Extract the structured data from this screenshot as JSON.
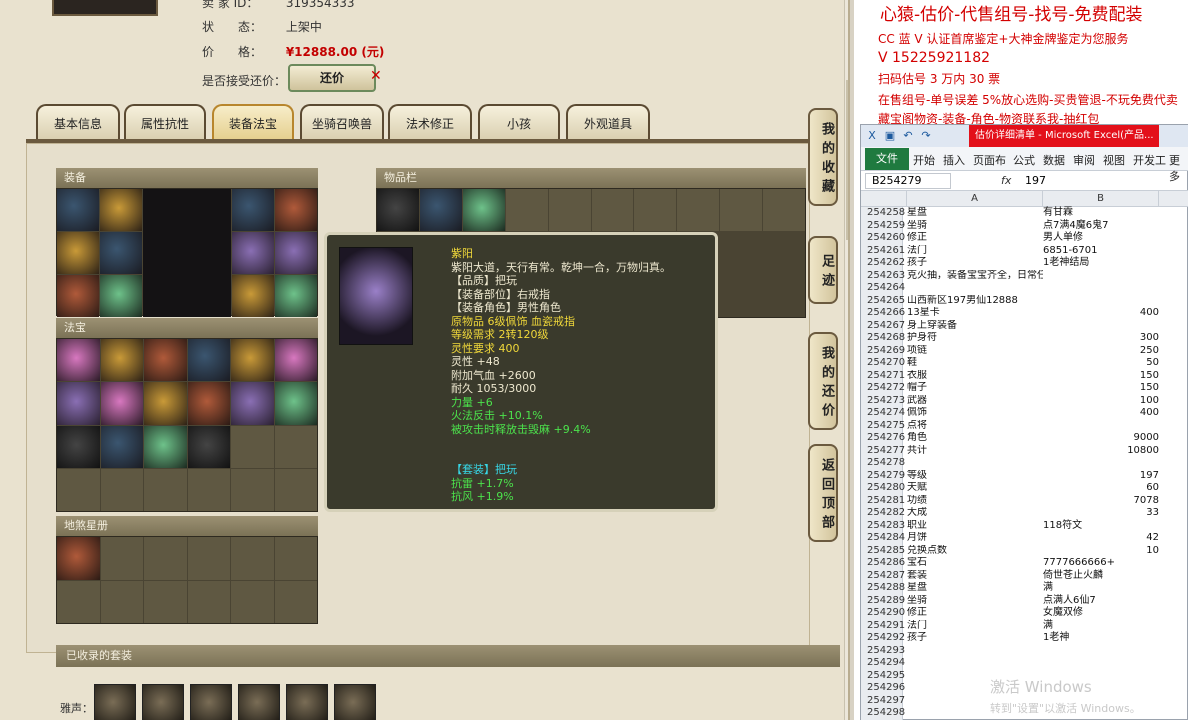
{
  "item_info": {
    "seller_label": "卖 家 ID：",
    "seller_value": "319354333",
    "status_label": "状　　态：",
    "status_value": "上架中",
    "price_label": "价　　格：",
    "price_value": "¥12888.00 (元)",
    "offer_label": "是否接受还价：",
    "offer_button": "还价"
  },
  "tabs": [
    "基本信息",
    "属性抗性",
    "装备法宝",
    "坐骑召唤兽",
    "法术修正",
    "小孩",
    "外观道具"
  ],
  "sections": {
    "equipment": "装备",
    "inventory": "物品栏",
    "fabao": "法宝",
    "fushi": "地煞星册",
    "collected_sets": "已收录的套装",
    "sets_row_label": "雅声："
  },
  "side_buttons": [
    "我的收藏",
    "足迹",
    "我的还价",
    "返回顶部"
  ],
  "tooltip": {
    "name": "紫阳",
    "lines": [
      {
        "text": "紫阳大道，天行有常。乾坤一合，万物归真。",
        "color": "white"
      },
      {
        "text": "【品质】把玩",
        "color": "white"
      },
      {
        "text": "【装备部位】右戒指",
        "color": "white"
      },
      {
        "text": "【装备角色】男性角色",
        "color": "white"
      },
      {
        "text": "原物品 6级佩饰 血瓷戒指",
        "color": "gold"
      },
      {
        "text": "等级需求 2转120级",
        "color": "gold"
      },
      {
        "text": "灵性要求 400",
        "color": "gold"
      },
      {
        "text": "灵性 +48",
        "color": "white"
      },
      {
        "text": "附加气血 +2600",
        "color": "white"
      },
      {
        "text": "耐久 1053/3000",
        "color": "white"
      },
      {
        "text": "力量 +6",
        "color": "green"
      },
      {
        "text": "火法反击 +10.1%",
        "color": "green"
      },
      {
        "text": "被攻击时释放击毁麻 +9.4%",
        "color": "green"
      },
      {
        "text": "",
        "color": "white"
      },
      {
        "text": "",
        "color": "white"
      },
      {
        "text": "【套装】把玩",
        "color": "cyan"
      },
      {
        "text": "抗雷 +1.7%",
        "color": "green"
      },
      {
        "text": "抗风 +1.9%",
        "color": "green"
      }
    ]
  },
  "ad": {
    "title": "心猿-估价-代售组号-找号-免费配装",
    "line1": "CC 蓝 V 认证首席鉴定+大神金牌鉴定为您服务",
    "line2": "V 15225921182",
    "line3": "扫码估号 3 万内 30 票",
    "line4": "在售组号-单号误差 5%放心选购-买贵管退-不玩免费代卖",
    "line5": "藏宝阁物资-装备-角色-物资联系我-抽红包"
  },
  "excel": {
    "title": "估价详细清单 - Microsoft Excel(产品...",
    "file_tab": "文件",
    "ribbon_tabs": [
      "开始",
      "插入",
      "页面布",
      "公式",
      "数据",
      "审阅",
      "视图",
      "开发工",
      "更多"
    ],
    "name_box": "B254279",
    "fx": "fx",
    "formula_value": "197",
    "col_a": "A",
    "col_b": "B",
    "rows": [
      {
        "n": "254258",
        "a": "星盘",
        "b": "有甘霖",
        "num": false
      },
      {
        "n": "254259",
        "a": "坐骑",
        "b": "点7满4魔6鬼7",
        "num": false
      },
      {
        "n": "254260",
        "a": "修正",
        "b": "男人单修",
        "num": false
      },
      {
        "n": "254261",
        "a": "法门",
        "b": "6851-6701",
        "num": false
      },
      {
        "n": "254262",
        "a": "孩子",
        "b": "1老神结局",
        "num": false
      },
      {
        "n": "254263",
        "a": "克火抽，装备宝宝齐全，日常任务副本满抽",
        "b": "",
        "num": false
      },
      {
        "n": "254264",
        "a": "",
        "b": "",
        "num": false
      },
      {
        "n": "254265",
        "a": "山西新区197男仙12888",
        "b": "",
        "num": false
      },
      {
        "n": "254266",
        "a": "13星卡",
        "b": "400",
        "num": true
      },
      {
        "n": "254267",
        "a": "身上穿装备",
        "b": "",
        "num": false
      },
      {
        "n": "254268",
        "a": "护身符",
        "b": "300",
        "num": true
      },
      {
        "n": "254269",
        "a": "项链",
        "b": "250",
        "num": true
      },
      {
        "n": "254270",
        "a": "鞋",
        "b": "50",
        "num": true
      },
      {
        "n": "254271",
        "a": "衣服",
        "b": "150",
        "num": true
      },
      {
        "n": "254272",
        "a": "帽子",
        "b": "150",
        "num": true
      },
      {
        "n": "254273",
        "a": "武器",
        "b": "100",
        "num": true
      },
      {
        "n": "254274",
        "a": "佩饰",
        "b": "400",
        "num": true
      },
      {
        "n": "254275",
        "a": "点将",
        "b": "",
        "num": false
      },
      {
        "n": "254276",
        "a": "角色",
        "b": "9000",
        "num": true
      },
      {
        "n": "254277",
        "a": "共计",
        "b": "10800",
        "num": true
      },
      {
        "n": "254278",
        "a": "",
        "b": "",
        "num": false
      },
      {
        "n": "254279",
        "a": "等级",
        "b": "197",
        "num": true
      },
      {
        "n": "254280",
        "a": "天赋",
        "b": "60",
        "num": true
      },
      {
        "n": "254281",
        "a": "功绩",
        "b": "7078",
        "num": true
      },
      {
        "n": "254282",
        "a": "大成",
        "b": "33",
        "num": true
      },
      {
        "n": "254283",
        "a": "职业",
        "b": "118符文",
        "num": false
      },
      {
        "n": "254284",
        "a": "月饼",
        "b": "42",
        "num": true
      },
      {
        "n": "254285",
        "a": "兑换点数",
        "b": "10",
        "num": true
      },
      {
        "n": "254286",
        "a": "宝石",
        "b": "7777666666+",
        "num": false
      },
      {
        "n": "254287",
        "a": "套装",
        "b": "倚世苍止火麟",
        "num": false
      },
      {
        "n": "254288",
        "a": "星盘",
        "b": "满",
        "num": false
      },
      {
        "n": "254289",
        "a": "坐骑",
        "b": "点满人6仙7",
        "num": false
      },
      {
        "n": "254290",
        "a": "修正",
        "b": "女魔双修",
        "num": false
      },
      {
        "n": "254291",
        "a": "法门",
        "b": "满",
        "num": false
      },
      {
        "n": "254292",
        "a": "孩子",
        "b": "1老神",
        "num": false
      },
      {
        "n": "254293",
        "a": "",
        "b": "",
        "num": false
      },
      {
        "n": "254294",
        "a": "",
        "b": "",
        "num": false
      },
      {
        "n": "254295",
        "a": "",
        "b": "",
        "num": false
      },
      {
        "n": "254296",
        "a": "",
        "b": "",
        "num": false
      },
      {
        "n": "254297",
        "a": "",
        "b": "",
        "num": false
      },
      {
        "n": "254298",
        "a": "",
        "b": "",
        "num": false
      }
    ]
  },
  "watermark": {
    "line1": "激活 Windows",
    "line2": "转到\"设置\"以激活 Windows。"
  }
}
